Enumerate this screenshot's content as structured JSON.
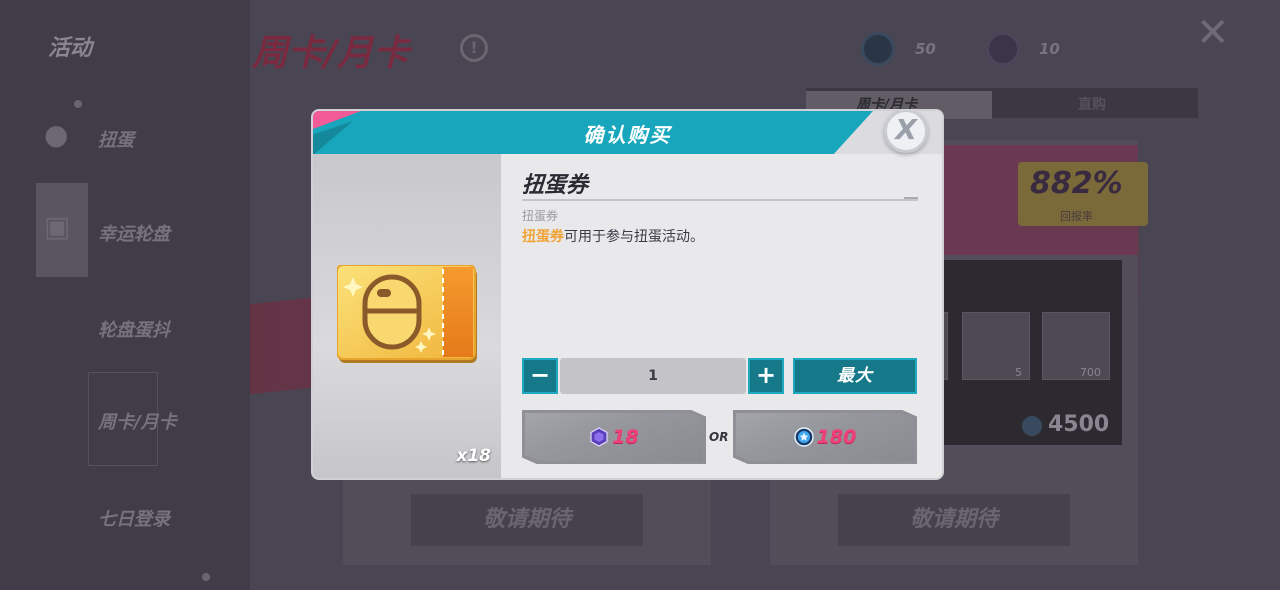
{
  "background": {
    "sidebar_title": "活动",
    "sidebar_items": [
      "扭蛋",
      "幸运轮盘",
      "轮盘蛋抖",
      "周卡/月卡",
      "七日登录"
    ],
    "page_title": "周卡/月卡",
    "currency": [
      {
        "icon": "blue-coin-icon",
        "value": "50"
      },
      {
        "icon": "purple-crystal-icon",
        "value": "10"
      }
    ],
    "tabs": [
      "周卡/月卡",
      "直购"
    ],
    "return_rate": "882%",
    "return_rate_label": "回报率",
    "reward_counts": [
      "5",
      "700"
    ],
    "price": "4500",
    "coming_soon_label": "敬请期待"
  },
  "modal": {
    "title": "确认购买",
    "close_icon": "close-x-icon",
    "item": {
      "icon": "gacha-ticket-icon",
      "count": "x18",
      "name": "扭蛋券",
      "subtitle": "扭蛋券",
      "desc_highlight": "扭蛋券",
      "desc_rest": "可用于参与扭蛋活动。"
    },
    "quantity": {
      "minus_label": "−",
      "value": "1",
      "plus_label": "+",
      "max_label": "最大"
    },
    "payment": {
      "option_a": {
        "icon": "purple-crystal-icon",
        "amount": "18"
      },
      "separator": "OR",
      "option_b": {
        "icon": "blue-coin-icon",
        "amount": "180"
      }
    }
  },
  "colors": {
    "header_band": "#17a6bc",
    "accent_pink": "#f25b97",
    "button_teal": "#15798a",
    "price_pink": "#f0407a",
    "highlight_orange": "#f1a335"
  }
}
